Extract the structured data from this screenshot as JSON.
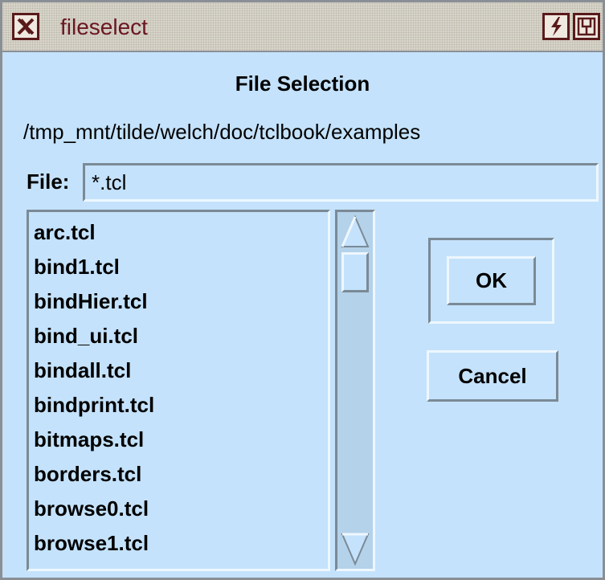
{
  "window": {
    "title": "fileselect"
  },
  "dialog": {
    "heading": "File Selection",
    "directory": "/tmp_mnt/tilde/welch/doc/tclbook/examples",
    "file_label": "File:",
    "file_value": "*.tcl"
  },
  "file_list": {
    "items": [
      "arc.tcl",
      "bind1.tcl",
      "bindHier.tcl",
      "bind_ui.tcl",
      "bindall.tcl",
      "bindprint.tcl",
      "bitmaps.tcl",
      "borders.tcl",
      "browse0.tcl",
      "browse1.tcl"
    ]
  },
  "buttons": {
    "ok_label": "OK",
    "cancel_label": "Cancel"
  },
  "colors": {
    "background": "#c4e2fb",
    "title_text": "#6b1620",
    "titlebar": "#d9d6cc"
  }
}
